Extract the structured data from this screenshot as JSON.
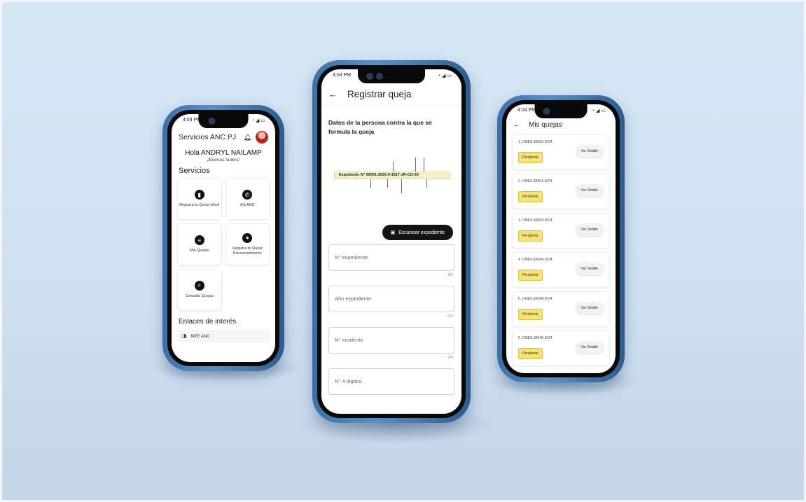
{
  "left_phone": {
    "status_time": "4:04 PM",
    "app_title": "Servicios ANC PJ",
    "greeting": "Hola ANDRYL NAILAMP",
    "greeting_sub": "¡Buenas tardes!",
    "services_title": "Servicios",
    "services": [
      {
        "label": "Registra tu Queja Movil",
        "icon": "document-icon"
      },
      {
        "label": "Aló ANC",
        "icon": "phone-icon"
      },
      {
        "label": "Mis Quejas",
        "icon": "list-icon"
      },
      {
        "label": "Registra tu Queja Presencialmente",
        "icon": "location-pin-icon"
      },
      {
        "label": "Consulta Quejas",
        "icon": "search-icon"
      }
    ],
    "links_title": "Enlaces de interés",
    "links": [
      {
        "label": "MPE ANC",
        "icon": "people-icon"
      }
    ]
  },
  "middle_phone": {
    "status_time": "4:04 PM",
    "title": "Registrar queja",
    "section_title": "Datos de la persona contra la que se formula la queja",
    "expediente_example": "Expediente N° 00001-2020-0-1817-JR-CO-05",
    "scan_button": "Escanear expediente",
    "fields": [
      {
        "placeholder": "N° expediente",
        "counter": "0/5"
      },
      {
        "placeholder": "Año expediente",
        "counter": "0/4"
      },
      {
        "placeholder": "N° incidente",
        "counter": "0/4"
      },
      {
        "placeholder": "N° 4 digitos",
        "counter": ""
      }
    ]
  },
  "right_phone": {
    "status_time": "4:04 PM",
    "title": "Mis quejas",
    "status_label": "Pendiente",
    "detail_label": "Ver Detalle",
    "complaints": [
      {
        "code": "1. OMES-83052-2024"
      },
      {
        "code": "2. OMES-83051-2024"
      },
      {
        "code": "3. OMES-83050-2024"
      },
      {
        "code": "4. OMES-83049-2024"
      },
      {
        "code": "5. OMES-83048-2024"
      },
      {
        "code": "6. OMES-83045-2024"
      }
    ]
  }
}
